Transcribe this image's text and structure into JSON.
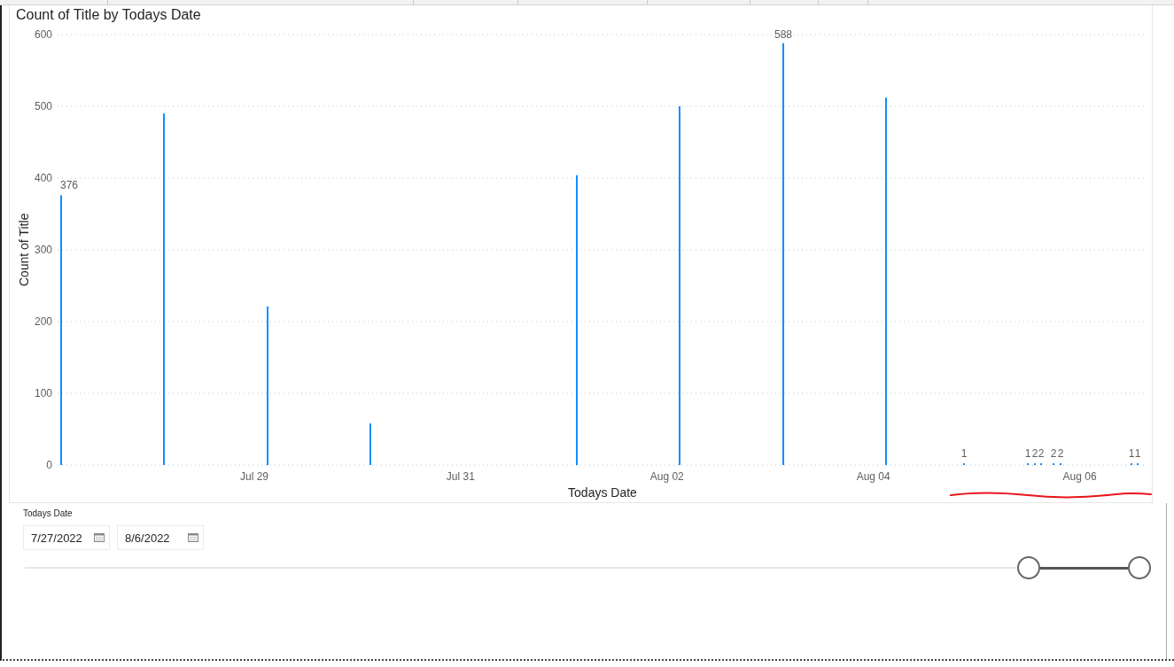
{
  "chart": {
    "chart_data": {
      "type": "bar",
      "title": "Count of Title by Todays Date",
      "xlabel": "Todays Date",
      "ylabel": "Count of Title",
      "grid": true,
      "categories": [
        null,
        null,
        null,
        null,
        null,
        null,
        null,
        null,
        null,
        null,
        null,
        null,
        null,
        null,
        null,
        null,
        null,
        null,
        null,
        null,
        null,
        null,
        null,
        null,
        null,
        null,
        null,
        null,
        null,
        null,
        "Jul 29",
        null,
        null,
        null,
        null,
        null,
        null,
        null,
        null,
        null,
        null,
        null,
        null,
        null,
        null,
        null,
        null,
        null,
        null,
        null,
        null,
        null,
        null,
        null,
        null,
        null,
        null,
        null,
        null,
        null,
        null,
        null,
        "Jul 31",
        null,
        null,
        null,
        null,
        null,
        null,
        null,
        null,
        null,
        null,
        null,
        null,
        null,
        null,
        null,
        null,
        null,
        null,
        null,
        null,
        null,
        null,
        null,
        null,
        null,
        null,
        null,
        null,
        null,
        null,
        null,
        "Aug 02",
        null,
        null,
        null,
        null,
        null,
        null,
        null,
        null,
        null,
        null,
        null,
        null,
        null,
        null,
        null,
        null,
        null,
        null,
        null,
        null,
        null,
        null,
        null,
        null,
        null,
        null,
        null,
        null,
        null,
        null,
        null,
        "Aug 04",
        null,
        null,
        null,
        null,
        null,
        null,
        null,
        null,
        null,
        null,
        null,
        null,
        null,
        null,
        null,
        null,
        null,
        null,
        null,
        null,
        null,
        null,
        null,
        null,
        null,
        null,
        null,
        null,
        null,
        null,
        null,
        "Aug 06",
        null,
        null,
        null,
        null,
        null,
        null,
        null,
        null,
        null,
        null
      ],
      "series": [
        {
          "color": "#118dff",
          "values": [
            376,
            null,
            null,
            null,
            null,
            null,
            null,
            null,
            null,
            null,
            null,
            null,
            null,
            null,
            null,
            null,
            490,
            null,
            null,
            null,
            null,
            null,
            null,
            null,
            null,
            null,
            null,
            null,
            null,
            null,
            null,
            null,
            221,
            null,
            null,
            null,
            null,
            null,
            null,
            null,
            null,
            null,
            null,
            null,
            null,
            null,
            null,
            null,
            58,
            null,
            null,
            null,
            null,
            null,
            null,
            null,
            null,
            null,
            null,
            null,
            null,
            null,
            null,
            null,
            null,
            null,
            null,
            null,
            null,
            null,
            null,
            null,
            null,
            null,
            null,
            null,
            null,
            null,
            null,
            null,
            404,
            null,
            null,
            null,
            null,
            null,
            null,
            null,
            null,
            null,
            null,
            null,
            null,
            null,
            null,
            null,
            500,
            null,
            null,
            null,
            null,
            null,
            null,
            null,
            null,
            null,
            null,
            null,
            null,
            null,
            null,
            null,
            588,
            null,
            null,
            null,
            null,
            null,
            null,
            null,
            null,
            null,
            null,
            null,
            null,
            null,
            null,
            null,
            512,
            null,
            null,
            null,
            null,
            null,
            null,
            null,
            null,
            null,
            null,
            null,
            1,
            null,
            null,
            null,
            null,
            null,
            null,
            null,
            null,
            null,
            1,
            2,
            2,
            null,
            2,
            2,
            null,
            null,
            null,
            null,
            null,
            null,
            null,
            null,
            null,
            null,
            1,
            1,
            null
          ]
        }
      ],
      "ylim": [
        0,
        600
      ],
      "yticks": [
        0,
        100,
        200,
        300,
        400,
        500,
        600
      ],
      "value_labels": [
        "376",
        null,
        null,
        null,
        null,
        null,
        null,
        null,
        null,
        null,
        null,
        null,
        null,
        null,
        null,
        null,
        null,
        null,
        null,
        null,
        null,
        null,
        null,
        null,
        null,
        null,
        null,
        null,
        null,
        null,
        null,
        null,
        null,
        null,
        null,
        null,
        null,
        null,
        null,
        null,
        null,
        null,
        null,
        null,
        null,
        null,
        null,
        null,
        null,
        null,
        null,
        null,
        null,
        null,
        null,
        null,
        null,
        null,
        null,
        null,
        null,
        null,
        null,
        null,
        null,
        null,
        null,
        null,
        null,
        null,
        null,
        null,
        null,
        null,
        null,
        null,
        null,
        null,
        null,
        null,
        null,
        null,
        null,
        null,
        null,
        null,
        null,
        null,
        null,
        null,
        null,
        null,
        null,
        null,
        null,
        null,
        null,
        null,
        null,
        null,
        null,
        null,
        null,
        null,
        null,
        null,
        null,
        null,
        null,
        null,
        null,
        null,
        "588",
        null,
        null,
        null,
        null,
        null,
        null,
        null,
        null,
        null,
        null,
        null,
        null,
        null,
        null,
        null,
        null,
        null,
        null,
        null,
        null,
        null,
        null,
        null,
        null,
        null,
        null,
        null,
        "1",
        null,
        null,
        null,
        null,
        null,
        null,
        null,
        null,
        null,
        "1",
        "2",
        "2",
        null,
        "2",
        "2",
        null,
        null,
        null,
        null,
        null,
        null,
        null,
        null,
        null,
        null,
        "1",
        "1",
        null
      ]
    }
  },
  "date_slicer": {
    "title": "Todays Date",
    "start_field": {
      "value": "7/27/2022"
    },
    "end_field": {
      "value": "8/6/2022"
    },
    "slider": {
      "handles": [
        {
          "level": 0.901
        },
        {
          "level": 1
        }
      ]
    }
  }
}
